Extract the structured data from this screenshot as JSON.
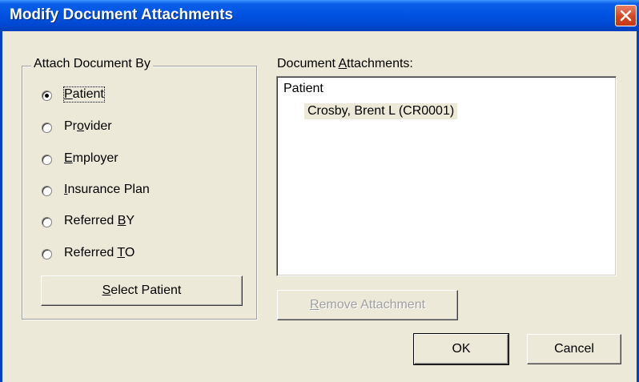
{
  "window": {
    "title": "Modify Document Attachments"
  },
  "attach_by": {
    "group_label": "Attach Document By",
    "options": [
      {
        "pre": "",
        "key": "P",
        "post": "atient",
        "checked": true
      },
      {
        "pre": "Pr",
        "key": "o",
        "post": "vider",
        "checked": false
      },
      {
        "pre": "",
        "key": "E",
        "post": "mployer",
        "checked": false
      },
      {
        "pre": "",
        "key": "I",
        "post": "nsurance Plan",
        "checked": false
      },
      {
        "pre": "Referred ",
        "key": "B",
        "post": "Y",
        "checked": false
      },
      {
        "pre": "Referred ",
        "key": "T",
        "post": "O",
        "checked": false
      }
    ],
    "select_button": {
      "key": "S",
      "post": "elect Patient"
    }
  },
  "attachments": {
    "label_pre": "Document ",
    "label_key": "A",
    "label_post": "ttachments:",
    "tree_root": "Patient",
    "tree_child": "Crosby, Brent L (CR0001)"
  },
  "buttons": {
    "remove": {
      "key": "R",
      "post": "emove Attachment"
    },
    "ok": "OK",
    "cancel": "Cancel"
  }
}
